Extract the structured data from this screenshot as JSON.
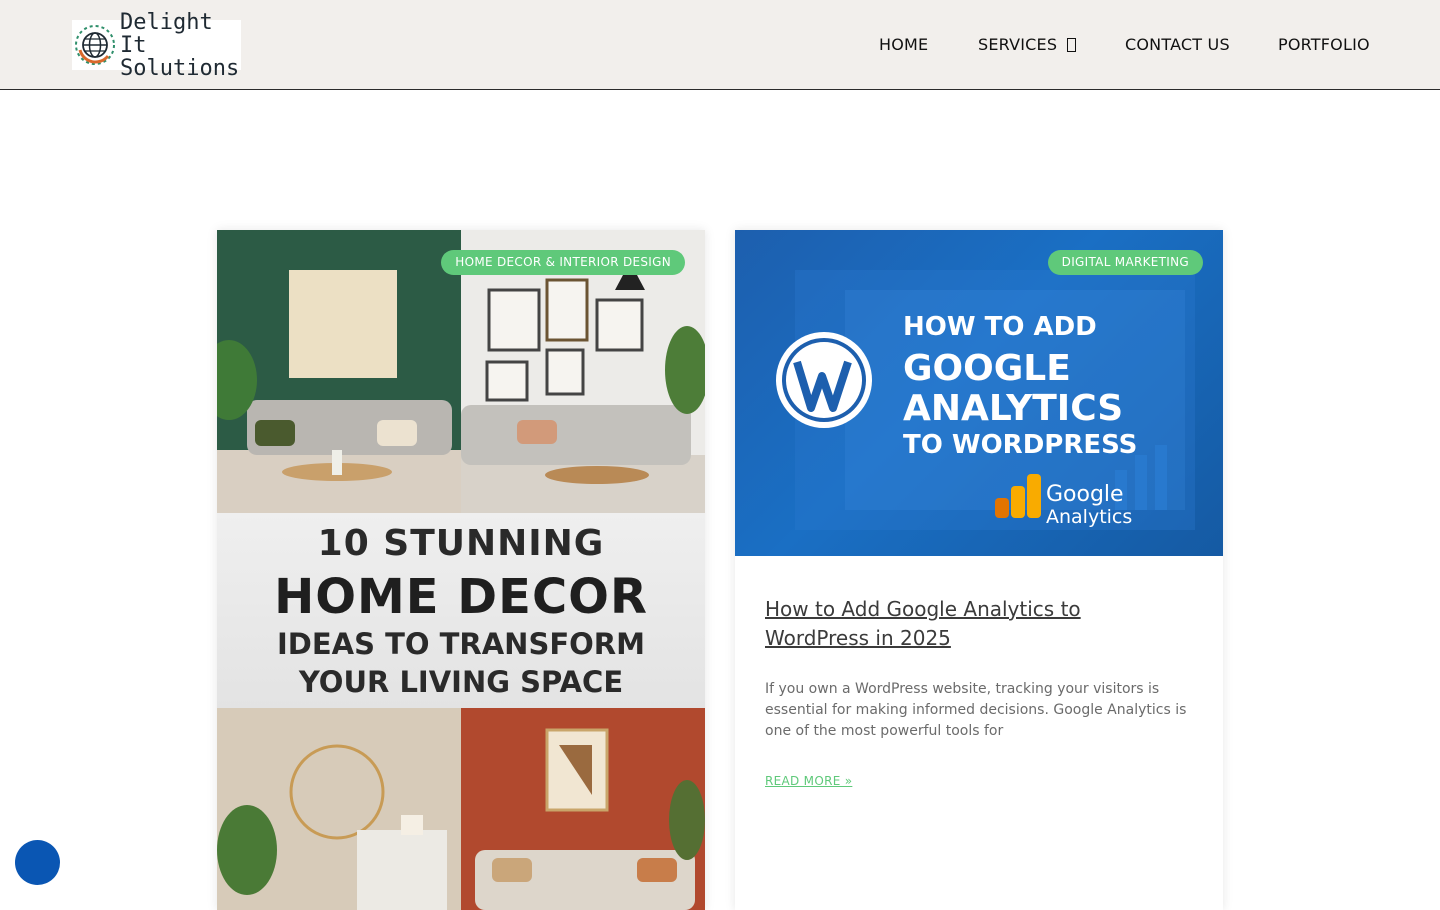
{
  "header": {
    "logo": {
      "line1": "Delight It",
      "line2": "Solutions"
    },
    "nav": [
      {
        "label": "HOME"
      },
      {
        "label": "SERVICES"
      },
      {
        "label": "CONTACT US"
      },
      {
        "label": "PORTFOLIO"
      }
    ],
    "background": "#f2efec"
  },
  "posts": [
    {
      "category": "HOME DECOR & INTERIOR DESIGN",
      "image_text": {
        "line1": "10 STUNNING",
        "line2": "HOME DECOR",
        "line3": "IDEAS TO TRANSFORM",
        "line4": "YOUR LIVING SPACE"
      }
    },
    {
      "category": "DIGITAL MARKETING",
      "image_text": {
        "line1": "HOW TO ADD",
        "line2": "GOOGLE",
        "line3": "ANALYTICS",
        "line4": "TO WORDPRESS",
        "brand1": "Google",
        "brand2": "Analytics"
      },
      "title": "How to Add Google Analytics to WordPress in 2025",
      "excerpt": "If you own a WordPress website, tracking your visitors is essential for making informed decisions. Google Analytics is one of the most powerful tools for",
      "read_more": "READ MORE »"
    }
  ],
  "colors": {
    "accent_green": "#5fc97a",
    "fab_blue": "#0a56b3"
  },
  "icons": {
    "logo": "globe-icon",
    "services_caret": "chevron-down-icon",
    "fab": "accessibility-icon"
  }
}
